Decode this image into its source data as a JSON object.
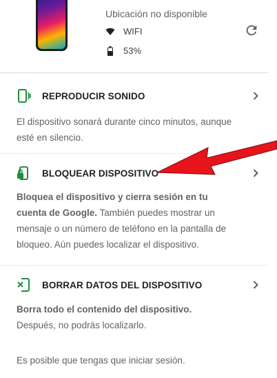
{
  "device": {
    "location": "Ubicación no disponible",
    "network": "WIFI",
    "battery": "53%",
    "icons": {
      "wifi": "wifi-icon",
      "battery": "battery-icon",
      "refresh": "refresh-icon"
    }
  },
  "sections": [
    {
      "title": "REPRODUCIR SONIDO",
      "icon": "phone-ring-icon",
      "description": "El dispositivo sonará durante cinco minutos, aunque esté en silencio."
    },
    {
      "title": "BLOQUEAR DISPOSITIVO",
      "icon": "phone-lock-icon",
      "description_bold": "Bloquea el dispositivo y cierra sesión en tu cuenta de Google.",
      "description_rest": " También puedes mostrar un mensaje o un número de teléfono en la pantalla de bloqueo. Aún puedes localizar el dispositivo."
    },
    {
      "title": "BORRAR DATOS DEL DISPOSITIVO",
      "icon": "phone-erase-icon",
      "description_bold": "Borra todo el contenido del dispositivo.",
      "description_rest": "Después, no podrás localizarlo.",
      "note": "Es posible que tengas que iniciar sesión."
    }
  ],
  "colors": {
    "accent": "#1e8e3e",
    "arrow": "#e8141b"
  }
}
